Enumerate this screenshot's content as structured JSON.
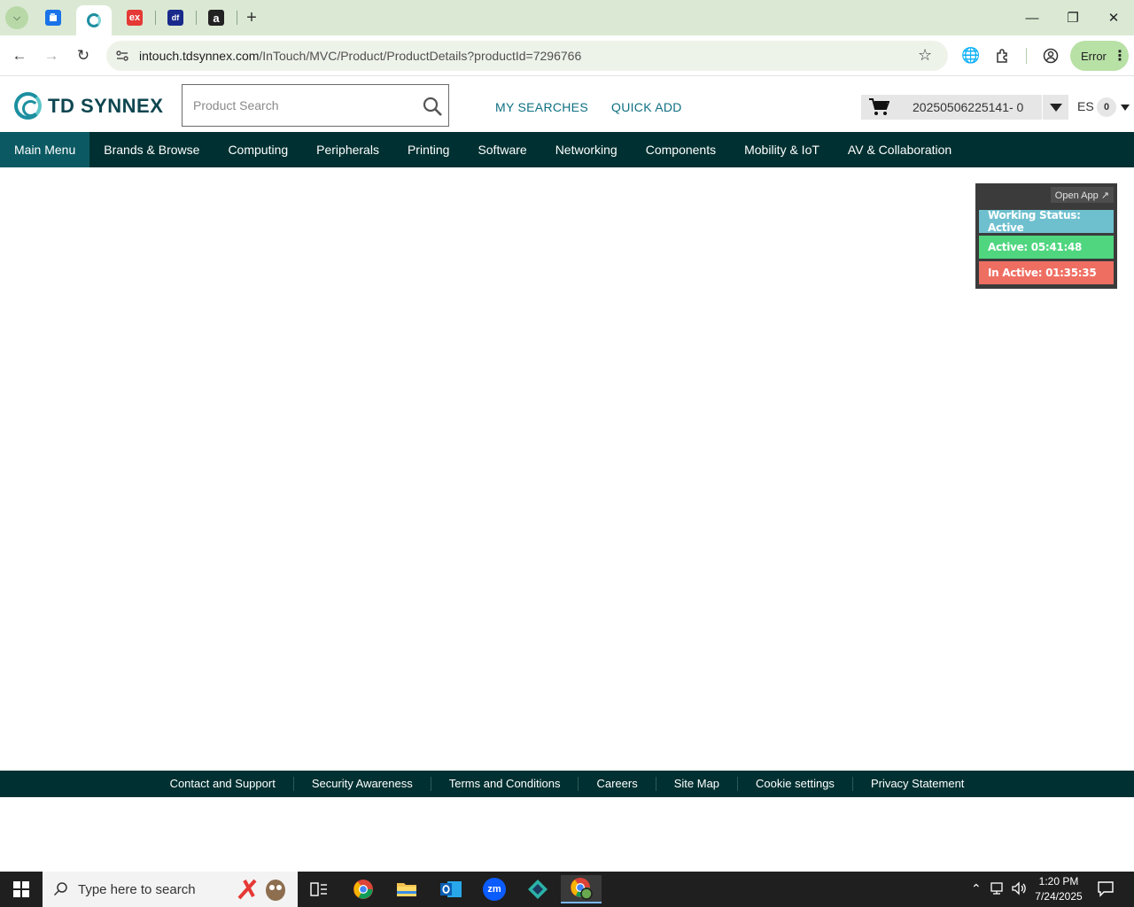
{
  "browser": {
    "tabs": [
      {
        "icon": "doc-favicon",
        "color": "#1a73e8",
        "active": false
      },
      {
        "icon": "tdsynnex-favicon",
        "color": "#1c8fa0",
        "active": true
      },
      {
        "icon": "ex-favicon",
        "label": "ex",
        "color": "#e53935",
        "active": false
      },
      {
        "icon": "df-favicon",
        "label": "df",
        "color": "#1a2a8c",
        "active": false
      },
      {
        "icon": "amazon-favicon",
        "label": "a",
        "color": "#222222",
        "active": false
      }
    ],
    "url_domain": "intouch.tdsynnex.com",
    "url_path": "/InTouch/MVC/Product/ProductDetails?productId=7296766",
    "profile_status": "Error"
  },
  "header": {
    "logo_text": "TD SYNNEX",
    "search_placeholder": "Product Search",
    "my_searches": "MY SEARCHES",
    "quick_add": "QUICK ADD",
    "cart_label": "20250506225141- 0",
    "user_initials": "ES",
    "notification_count": "0"
  },
  "nav": {
    "items": [
      "Main Menu",
      "Brands & Browse",
      "Computing",
      "Peripherals",
      "Printing",
      "Software",
      "Networking",
      "Components",
      "Mobility & IoT",
      "AV & Collaboration"
    ]
  },
  "widget": {
    "open_app": "Open App ↗",
    "working_status": "Working Status: Active",
    "active": "Active: 05:41:48",
    "inactive": "In Active: 01:35:35",
    "colors": {
      "status": "#6fc0cf",
      "active": "#4fd67f",
      "inactive": "#ef6e62"
    }
  },
  "footer": {
    "links": [
      "Contact and Support",
      "Security Awareness",
      "Terms and Conditions",
      "Careers",
      "Site Map",
      "Cookie settings",
      "Privacy Statement"
    ]
  },
  "taskbar": {
    "search_placeholder": "Type here to search",
    "time": "1:20 PM",
    "date": "7/24/2025"
  }
}
